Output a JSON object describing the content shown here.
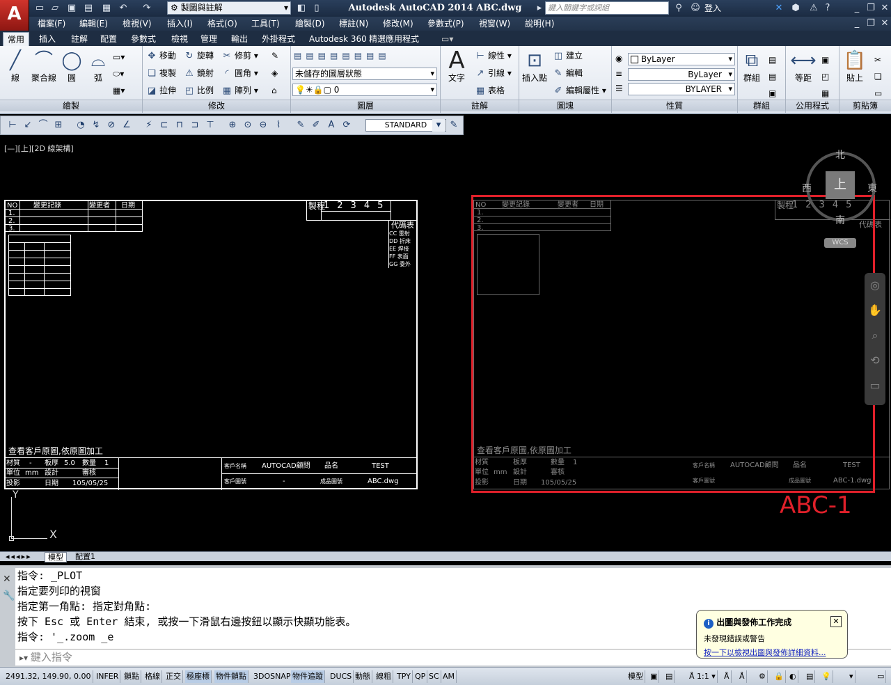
{
  "title_bar": {
    "logo": "A",
    "workspace": "製圖與註解",
    "app_title": "Autodesk AutoCAD 2014    ABC.dwg",
    "search_placeholder": "鍵入關鍵字或詞組",
    "login": "登入"
  },
  "menu": [
    "檔案(F)",
    "編輯(E)",
    "檢視(V)",
    "插入(I)",
    "格式(O)",
    "工具(T)",
    "繪製(D)",
    "標註(N)",
    "修改(M)",
    "參數式(P)",
    "視窗(W)",
    "說明(H)"
  ],
  "ribbon_tabs": [
    "常用",
    "插入",
    "註解",
    "配置",
    "參數式",
    "檢視",
    "管理",
    "輸出",
    "外掛程式",
    "Autodesk 360",
    "精選應用程式"
  ],
  "panels": {
    "draw": {
      "title": "繪製",
      "line": "線",
      "polyline": "聚合線",
      "circle": "圓",
      "arc": "弧"
    },
    "modify": {
      "title": "修改",
      "move": "移動",
      "rotate": "旋轉",
      "trim": "修剪",
      "copy": "複製",
      "mirror": "鏡射",
      "fillet": "圓角",
      "stretch": "拉伸",
      "scale": "比例",
      "array": "陣列"
    },
    "layers": {
      "title": "圖層",
      "state": "未儲存的圖層狀態",
      "current": "0"
    },
    "annotation": {
      "title": "註解",
      "text": "文字",
      "dim": "線性",
      "leader": "引線",
      "table": "表格"
    },
    "block": {
      "title": "圖塊",
      "insert": "插入點",
      "create": "建立",
      "edit": "編輯",
      "attr": "編輯屬性"
    },
    "properties": {
      "title": "性質",
      "color": "ByLayer",
      "linetype": "ByLayer",
      "lineweight": "BYLAYER"
    },
    "groups": {
      "title": "群組",
      "group": "群組"
    },
    "utilities": {
      "title": "公用程式",
      "measure": "等距"
    },
    "clipboard": {
      "title": "剪貼簿",
      "paste": "貼上"
    }
  },
  "toolbar2": {
    "dimstyle": "STANDARD"
  },
  "canvas": {
    "viewport_label": "[—][上][2D 線架構]",
    "viewcube": {
      "north": "北",
      "south": "南",
      "east": "東",
      "west": "西",
      "top": "上",
      "wcs": "WCS"
    },
    "annotation": "ABC-1",
    "ucs": {
      "x": "X",
      "y": "Y"
    },
    "left_frame": {
      "note": "查看客戶原圖,依原圖加工",
      "file": "ABC.dwg",
      "client": "AUTOCAD顧問",
      "part": "TEST",
      "date": "105/05/25"
    },
    "right_frame": {
      "note": "查看客戶原圖,依原圖加工",
      "file": "ABC-1.dwg",
      "client": "AUTOCAD顧問",
      "part": "TEST",
      "date": "105/05/25"
    },
    "table_headers": {
      "no": "NO",
      "change": "變更記錄",
      "changer": "變更者",
      "date": "日期",
      "process": "製程",
      "code": "代碼表"
    },
    "code_rows": [
      "CC 雷射",
      "DD 折床",
      "EE 焊接",
      "FF 表面",
      "GG 委外"
    ],
    "title_block": {
      "material": "材質",
      "thickness": "板厚",
      "thick_val": "5.0",
      "qty": "數量",
      "qty_val": "1",
      "unit": "單位",
      "unit_val": "mm",
      "design": "設計",
      "review": "審核",
      "projection": "投影",
      "date_l": "日期",
      "client_l": "客戶名稱",
      "client_drawing": "客戶圖號",
      "part_l": "品名",
      "file_l": "成品圖號",
      "dash": "-"
    }
  },
  "layout_tabs": [
    "模型",
    "配置1"
  ],
  "command_history": [
    "指令: _PLOT",
    "指定要列印的視窗",
    "指定第一角點: 指定對角點:",
    "按下 Esc 或 Enter 結束, 或按一下滑鼠右邊按鈕以顯示快顯功能表。",
    "指令: '_.zoom _e"
  ],
  "command_placeholder": "鍵入指令",
  "notification": {
    "title": "出圖與發佈工作完成",
    "line1": "未發現錯誤或警告",
    "link": "按一下以檢視出圖與發佈詳細資料..."
  },
  "status": {
    "coords": "2491.32, 149.90, 0.00",
    "buttons": [
      "INFER",
      "鎖點",
      "格線",
      "正交",
      "極座標",
      "物件鎖點",
      "3DOSNAP",
      "物件追蹤",
      "DUCS",
      "動態",
      "線粗",
      "TPY",
      "QP",
      "SC",
      "AM"
    ],
    "model": "模型",
    "scale": "1:1"
  }
}
